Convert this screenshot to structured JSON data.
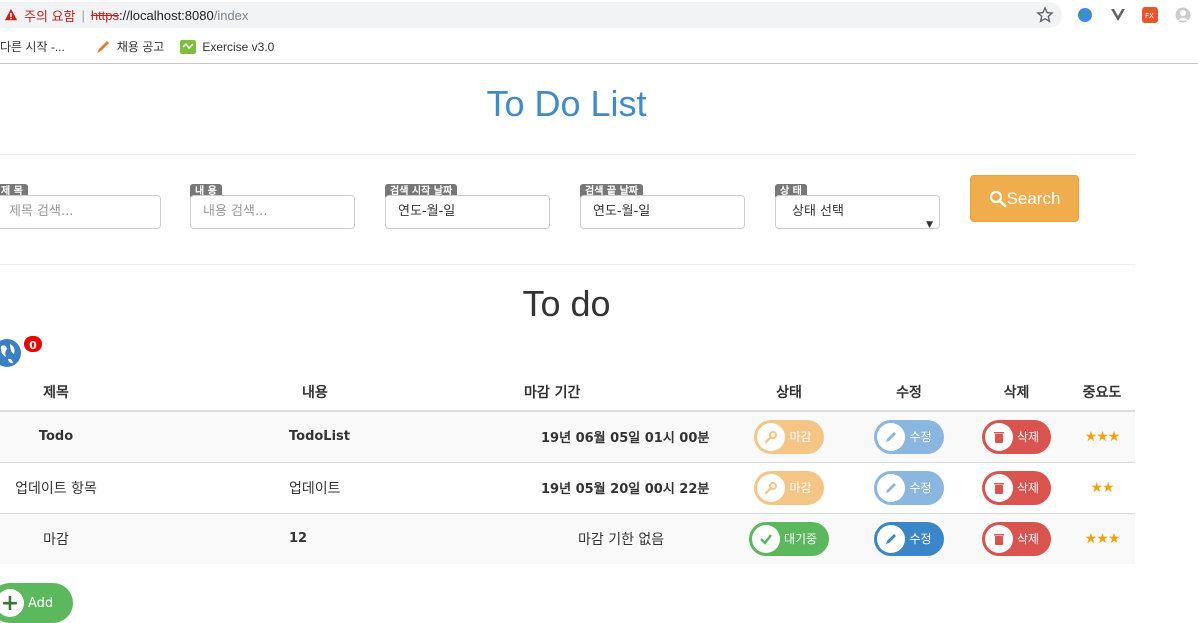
{
  "browser": {
    "warning": "주의 요함",
    "separator": "|",
    "url_scheme": "https",
    "url_host": "://localhost:8080",
    "url_path": "/index",
    "bookmarks": [
      {
        "label": "다른 시작 -..."
      },
      {
        "label": "채용 공고"
      },
      {
        "label": "Exercise v3.0"
      }
    ]
  },
  "page": {
    "title": "To Do List",
    "search": {
      "title_label": "제 목",
      "title_placeholder": "제목 검색...",
      "content_label": "내 용",
      "content_placeholder": "내용 검색...",
      "start_label": "검색 시작 날짜",
      "start_value": "연도-월-일",
      "end_label": "검색 끝 날짜",
      "end_value": "연도-월-일",
      "status_label": "상 태",
      "status_value": "상태 선택",
      "button": "Search"
    },
    "list_heading": "To do",
    "notification_count": "0",
    "table": {
      "headers": [
        "제목",
        "내용",
        "마감 기간",
        "상태",
        "수정",
        "삭제",
        "중요도"
      ],
      "rows": [
        {
          "title": "Todo",
          "content": "TodoList",
          "deadline": "19년 06월 05일 01시 00분",
          "status": "마감",
          "edit": "수정",
          "delete": "삭제",
          "stars": "★★★"
        },
        {
          "title": "업데이트 항목",
          "content": "업데이트",
          "deadline": "19년 05월 20일 00시 22분",
          "status": "마감",
          "edit": "수정",
          "delete": "삭제",
          "stars": "★★"
        },
        {
          "title": "마감",
          "content": "12",
          "deadline": "마감 기한 없음",
          "status": "대기중",
          "edit": "수정",
          "delete": "삭제",
          "stars": "★★★"
        }
      ]
    },
    "add_button": "Add"
  },
  "colors": {
    "title": "#428bca",
    "warning_btn": "#f0ad4e",
    "danger": "#d9534f",
    "success": "#5cb85c",
    "info": "#3a86c8"
  }
}
